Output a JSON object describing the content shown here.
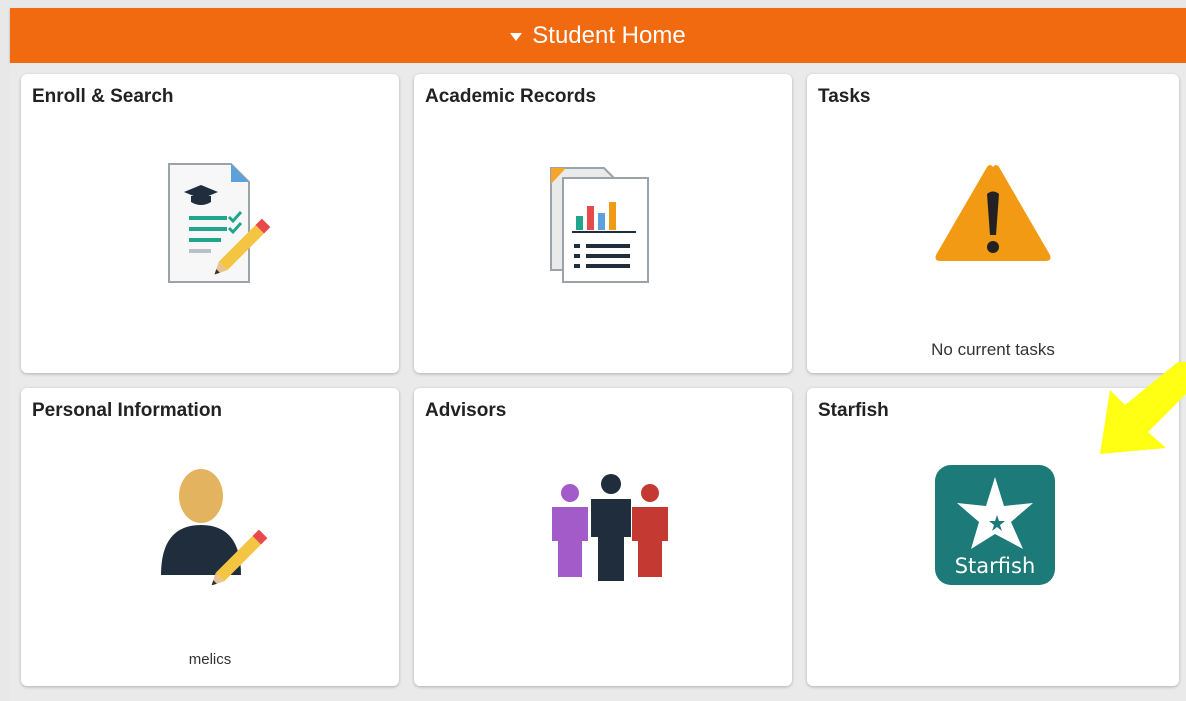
{
  "header": {
    "title": "Student Home"
  },
  "tiles": [
    {
      "title": "Enroll & Search",
      "icon": "enroll-document-pencil-icon"
    },
    {
      "title": "Academic Records",
      "icon": "report-chart-icon"
    },
    {
      "title": "Tasks",
      "icon": "warning-triangle-icon",
      "footer": "No current tasks"
    },
    {
      "title": "Personal Information",
      "icon": "person-edit-icon",
      "footer": "melics"
    },
    {
      "title": "Advisors",
      "icon": "people-group-icon"
    },
    {
      "title": "Starfish",
      "icon": "starfish-logo-icon",
      "logo_text": "Starfish"
    }
  ],
  "colors": {
    "header": "#f26a0f",
    "warning": "#f29a13",
    "starfish": "#1c7a78",
    "pointer_arrow": "#ffff14"
  }
}
